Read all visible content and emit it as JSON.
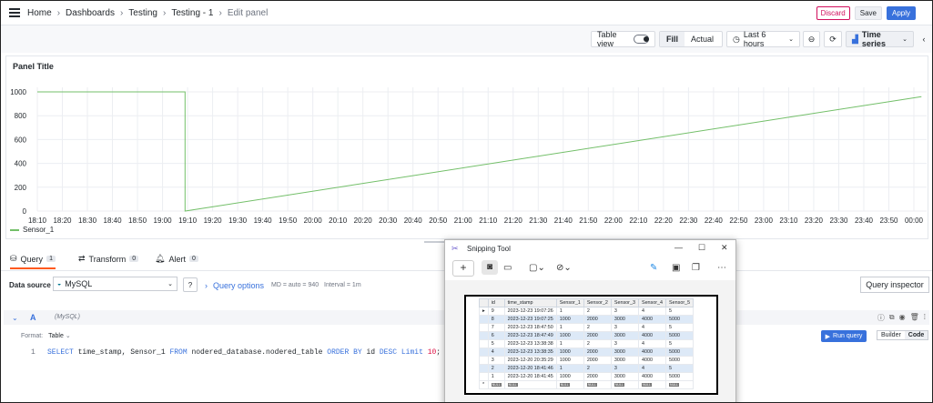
{
  "breadcrumb": {
    "items": [
      "Home",
      "Dashboards",
      "Testing",
      "Testing - 1"
    ],
    "current": "Edit panel"
  },
  "actions": {
    "discard": "Discard",
    "save": "Save",
    "apply": "Apply"
  },
  "toolbar": {
    "table_view": "Table view",
    "fill": "Fill",
    "actual": "Actual",
    "time_range": "Last 6 hours",
    "viz": "Time series"
  },
  "panel": {
    "title": "Panel Title"
  },
  "chart_data": {
    "type": "line",
    "ylim": [
      0,
      1000
    ],
    "yticks": [
      0,
      200,
      400,
      600,
      800,
      1000
    ],
    "xticks": [
      "18:10",
      "18:20",
      "18:30",
      "18:40",
      "18:50",
      "19:00",
      "19:10",
      "19:20",
      "19:30",
      "19:40",
      "19:50",
      "20:00",
      "20:10",
      "20:20",
      "20:30",
      "20:40",
      "20:50",
      "21:00",
      "21:10",
      "21:20",
      "21:30",
      "21:40",
      "21:50",
      "22:00",
      "22:10",
      "22:20",
      "22:30",
      "22:40",
      "22:50",
      "23:00",
      "23:10",
      "23:20",
      "23:30",
      "23:40",
      "23:50",
      "00:00"
    ],
    "grid": true,
    "legend": "bottom-left",
    "series": [
      {
        "name": "Sensor_1",
        "color": "#73bf69",
        "points": [
          [
            "18:10",
            1000
          ],
          [
            "19:09",
            1000
          ],
          [
            "19:09",
            0
          ],
          [
            "00:03",
            960
          ]
        ]
      }
    ]
  },
  "tabs": [
    {
      "label": "Query",
      "count": "1"
    },
    {
      "label": "Transform",
      "count": "0"
    },
    {
      "label": "Alert",
      "count": "0"
    }
  ],
  "datasource": {
    "label": "Data source",
    "value": "MySQL",
    "options_label": "Query options",
    "md": "MD = auto = 940",
    "interval": "Interval = 1m",
    "inspector": "Query inspector"
  },
  "query": {
    "ref": "A",
    "source": "(MySQL)",
    "format_label": "Format:",
    "format_value": "Table",
    "run": "Run query",
    "builder": "Builder",
    "code": "Code",
    "line_number": "1",
    "sql": {
      "kw_select": "SELECT",
      "fields": " time_stamp, Sensor_1 ",
      "kw_from": "FROM",
      "table": " nodered_database.nodered_table ",
      "kw_order": "ORDER BY",
      "col": " id ",
      "kw_desc": "DESC",
      "kw_limit": " Limit ",
      "limit": "10",
      "end": ";"
    }
  },
  "snipping_tool": {
    "title": "Snipping Tool",
    "columns": [
      "id",
      "time_stamp",
      "Sensor_1",
      "Sensor_2",
      "Sensor_3",
      "Sensor_4",
      "Sensor_5"
    ],
    "rows": [
      [
        "9",
        "2023-12-23 19:07:26",
        "1",
        "2",
        "3",
        "4",
        "5"
      ],
      [
        "8",
        "2023-12-23 19:07:25",
        "1000",
        "2000",
        "3000",
        "4000",
        "5000"
      ],
      [
        "7",
        "2023-12-23 18:47:50",
        "1",
        "2",
        "3",
        "4",
        "5"
      ],
      [
        "6",
        "2023-12-23 18:47:49",
        "1000",
        "2000",
        "3000",
        "4000",
        "5000"
      ],
      [
        "5",
        "2023-12-23 13:38:38",
        "1",
        "2",
        "3",
        "4",
        "5"
      ],
      [
        "4",
        "2023-12-23 13:38:35",
        "1000",
        "2000",
        "3000",
        "4000",
        "5000"
      ],
      [
        "3",
        "2023-12-20 20:35:29",
        "1000",
        "2000",
        "3000",
        "4000",
        "5000"
      ],
      [
        "2",
        "2023-12-20 18:41:46",
        "1",
        "2",
        "3",
        "4",
        "5"
      ],
      [
        "1",
        "2023-12-20 18:41:45",
        "1000",
        "2000",
        "3000",
        "4000",
        "5000"
      ]
    ],
    "null_label": "NULL"
  }
}
